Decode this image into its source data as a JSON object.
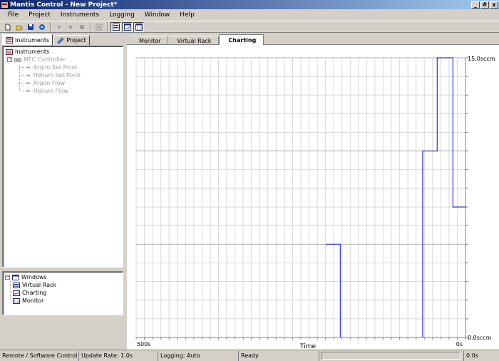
{
  "window": {
    "title": "Mantis Control - New Project*",
    "buttons": [
      "_",
      "#",
      "x"
    ]
  },
  "menu": [
    "File",
    "Project",
    "Instruments",
    "Logging",
    "Window",
    "Help"
  ],
  "toolbar": {
    "icons": [
      "new-icon",
      "open-icon",
      "save-icon",
      "connect-icon",
      "play-icon",
      "pause-icon",
      "stop-icon",
      "record-icon",
      "virtual-rack-icon",
      "charting-icon",
      "monitor-icon"
    ]
  },
  "left_tabs": [
    {
      "label": "Instruments",
      "active": true
    },
    {
      "label": "Project",
      "active": false
    }
  ],
  "tree": {
    "root": "Instruments",
    "controller": "MFC Controller",
    "children": [
      "Argon Set Point",
      "Helium Set Point",
      "Argon Flow",
      "Helium Flow"
    ]
  },
  "windows_panel": {
    "root": "Windows",
    "items": [
      "Virtual Rack",
      "Charting",
      "Monitor"
    ]
  },
  "right_tabs": [
    {
      "label": "Monitor",
      "active": false
    },
    {
      "label": "Virtual Rack",
      "active": false
    },
    {
      "label": "Charting",
      "active": true
    }
  ],
  "chart_data": {
    "type": "line",
    "xlabel": "Time",
    "x_tick_labels": [
      "500s",
      "0s"
    ],
    "y_tick_labels": [
      "15.0sccm",
      "0.0sccm"
    ],
    "xlim": [
      500,
      0
    ],
    "ylim": [
      0,
      15
    ],
    "grid": true,
    "series": [
      {
        "color": "#3333cc",
        "points": [
          [
            212,
            5
          ],
          [
            190,
            5
          ],
          [
            190,
            0
          ]
        ]
      },
      {
        "color": "#3333cc",
        "points": [
          [
            65,
            0
          ],
          [
            65,
            10
          ],
          [
            43,
            10
          ],
          [
            43,
            15
          ],
          [
            19,
            15
          ],
          [
            19,
            7
          ],
          [
            0,
            7
          ]
        ]
      }
    ]
  },
  "status": {
    "mode": "Remote / Software Control",
    "update_rate": "Update Rate: 1.0s",
    "logging": "Logging: Auto",
    "state": "Ready",
    "elapsed": "0.0s"
  }
}
